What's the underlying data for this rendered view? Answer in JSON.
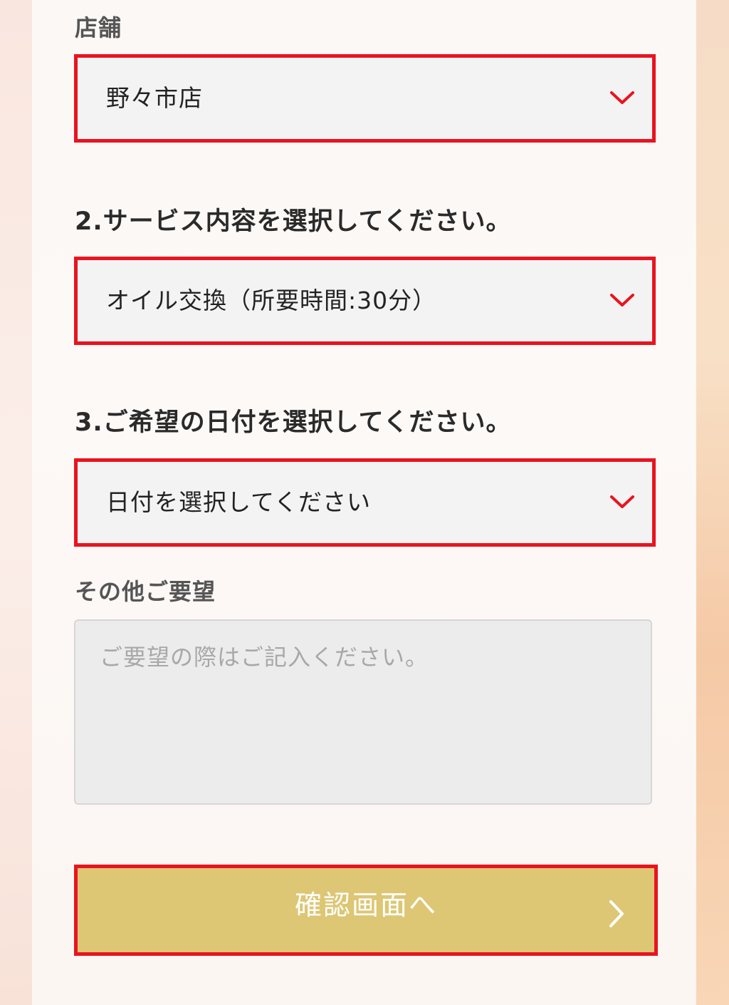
{
  "store": {
    "label": "店舗",
    "selected": "野々市店"
  },
  "service": {
    "heading": "2.サービス内容を選択してください。",
    "selected": "オイル交換（所要時間:30分）"
  },
  "date": {
    "heading": "3.ご希望の日付を選択してください。",
    "selected": "日付を選択してください"
  },
  "requests": {
    "label": "その他ご要望",
    "placeholder": "ご要望の際はご記入ください。"
  },
  "submit": {
    "label": "確認画面へ"
  },
  "icons": {
    "select_arrow": "chevron-down-icon",
    "submit_arrow": "chevron-right-icon"
  },
  "colors": {
    "highlight_border": "#e8141f",
    "chevron": "#e8141f",
    "submit_bg": "#ddc774"
  }
}
